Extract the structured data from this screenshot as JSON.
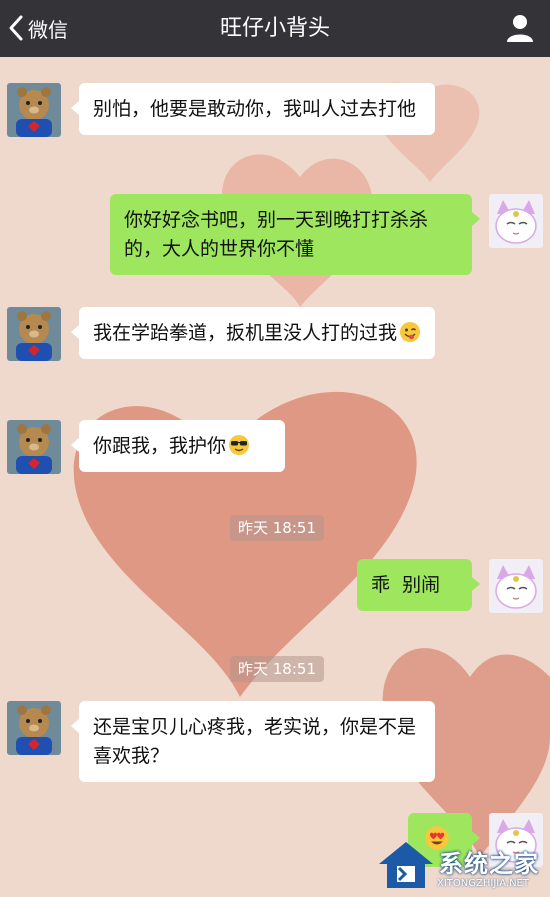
{
  "nav": {
    "back_label": "微信",
    "title": "旺仔小背头"
  },
  "messages": [
    {
      "side": "left",
      "text": "别怕，他要是敢动你，我叫人过去打他"
    },
    {
      "side": "right",
      "text": "你好好念书吧，别一天到晚打打杀杀的，大人的世界你不懂"
    },
    {
      "side": "left",
      "text": "我在学跆拳道，扳机里没人打的过我",
      "emoji": "wink-tongue-emoji"
    },
    {
      "side": "left",
      "text": "你跟我，我护你",
      "emoji": "sunglasses-emoji"
    },
    {
      "side": "right",
      "text": "乖  别闹"
    },
    {
      "side": "left",
      "text": "还是宝贝儿心疼我，老实说，你是不是喜欢我？"
    },
    {
      "side": "right",
      "text": "",
      "emoji": "heart-eyes-emoji"
    }
  ],
  "timestamps": [
    "昨天 18:51",
    "昨天 18:51"
  ],
  "watermark": {
    "text": "系统之家",
    "url": "XITONGZHIJIA.NET"
  },
  "colors": {
    "navbar": "#333338",
    "background": "#efd9cc",
    "bubble_self": "#9de65d",
    "bubble_other": "#ffffff"
  }
}
